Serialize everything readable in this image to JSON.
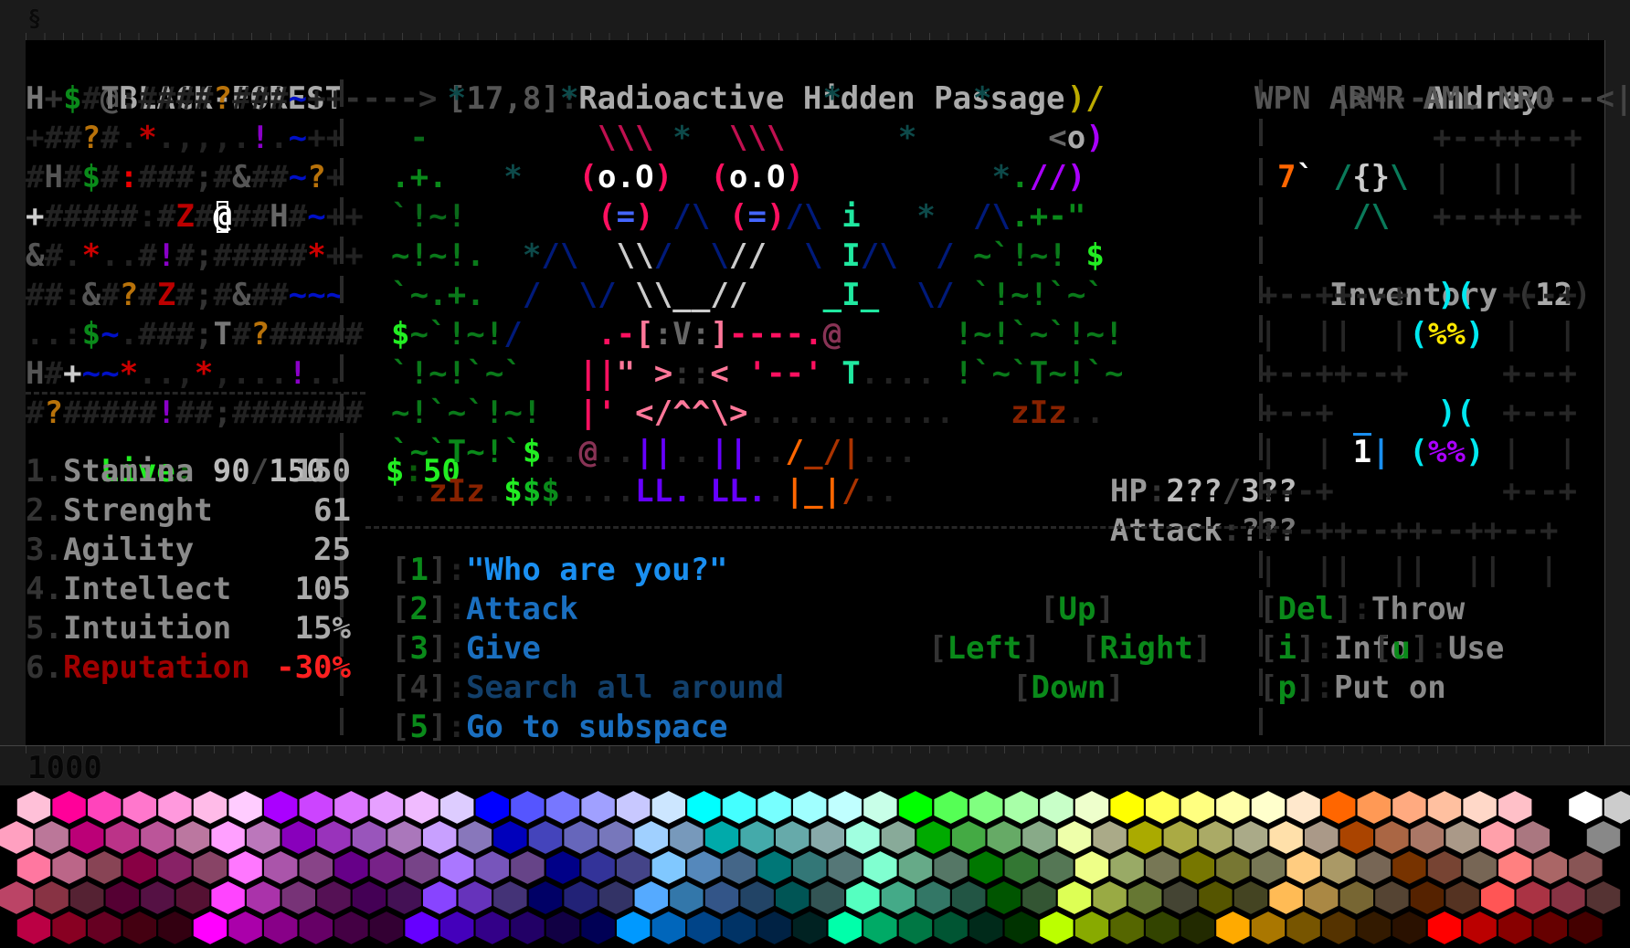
{
  "window": {
    "top_indicator": "§",
    "bottom_counter": "1000"
  },
  "header": {
    "location_left": "@BLACK-FOREST---->",
    "coords": "[17,8]",
    "coords_sep": ":",
    "location_title": "Radioactive Hidden Passage",
    "player_name": "Andrey",
    "player_frame_left": "|>---",
    "player_frame_right": "---<|"
  },
  "minimap": {
    "rows": [
      [
        [
          "H",
          "#777"
        ],
        [
          "+",
          "#333"
        ],
        [
          "$",
          "#0a8a1a"
        ],
        [
          "#",
          "#222"
        ],
        [
          "T",
          "#777"
        ],
        [
          ":",
          "#222"
        ],
        [
          "#",
          "#222"
        ],
        [
          "#",
          "#222"
        ],
        [
          "#",
          "#222"
        ],
        [
          "#",
          "#222"
        ],
        [
          "?",
          "#b8720a"
        ],
        [
          "#",
          "#222"
        ],
        [
          "#",
          "#222"
        ],
        [
          "#",
          "#222"
        ],
        [
          "~",
          "#0010c8"
        ],
        [
          "+",
          "#222"
        ],
        [
          "+",
          "#222"
        ]
      ],
      [
        [
          "+",
          "#222"
        ],
        [
          "#",
          "#222"
        ],
        [
          "#",
          "#222"
        ],
        [
          "?",
          "#b8720a"
        ],
        [
          "#",
          "#222"
        ],
        [
          ".",
          "#222"
        ],
        [
          "*",
          "#b00"
        ],
        [
          ".",
          "#222"
        ],
        [
          ",",
          "#222"
        ],
        [
          ",",
          "#222"
        ],
        [
          ",",
          "#222"
        ],
        [
          ".",
          "#222"
        ],
        [
          "!",
          "#8a00c8"
        ],
        [
          ".",
          "#222"
        ],
        [
          "~",
          "#0010c8"
        ],
        [
          "+",
          "#222"
        ],
        [
          "+",
          "#222"
        ]
      ],
      [
        [
          "#",
          "#222"
        ],
        [
          "H",
          "#555"
        ],
        [
          "#",
          "#222"
        ],
        [
          "$",
          "#0a8a1a"
        ],
        [
          "#",
          "#222"
        ],
        [
          ":",
          "#e00"
        ],
        [
          "#",
          "#222"
        ],
        [
          "#",
          "#222"
        ],
        [
          "#",
          "#222"
        ],
        [
          ";",
          "#333"
        ],
        [
          "#",
          "#222"
        ],
        [
          "&",
          "#555"
        ],
        [
          "#",
          "#222"
        ],
        [
          "#",
          "#222"
        ],
        [
          "~",
          "#0010c8"
        ],
        [
          "?",
          "#b8720a"
        ],
        [
          "+",
          "#222"
        ]
      ],
      [
        [
          "+",
          "#ccc"
        ],
        [
          "#",
          "#222"
        ],
        [
          "#",
          "#222"
        ],
        [
          "#",
          "#222"
        ],
        [
          "#",
          "#222"
        ],
        [
          "#",
          "#222"
        ],
        [
          ":",
          "#222"
        ],
        [
          "#",
          "#222"
        ],
        [
          "Z",
          "#b00"
        ],
        [
          "#",
          "#222"
        ],
        [
          "@",
          "#fff"
        ],
        [
          "#",
          "#222"
        ],
        [
          "#",
          "#222"
        ],
        [
          "H",
          "#666"
        ],
        [
          "#",
          "#222"
        ],
        [
          "~",
          "#0010c8"
        ],
        [
          "+",
          "#222"
        ],
        [
          "+",
          "#222"
        ]
      ],
      [
        [
          "&",
          "#555"
        ],
        [
          "#",
          "#222"
        ],
        [
          ".",
          "#222"
        ],
        [
          "*",
          "#c00"
        ],
        [
          ".",
          "#222"
        ],
        [
          ".",
          "#222"
        ],
        [
          "#",
          "#222"
        ],
        [
          "!",
          "#8a00c8"
        ],
        [
          "#",
          "#222"
        ],
        [
          ";",
          "#333"
        ],
        [
          "#",
          "#222"
        ],
        [
          "#",
          "#222"
        ],
        [
          "#",
          "#222"
        ],
        [
          "#",
          "#222"
        ],
        [
          "#",
          "#222"
        ],
        [
          "*",
          "#c00"
        ],
        [
          "+",
          "#222"
        ],
        [
          "+",
          "#222"
        ]
      ],
      [
        [
          "#",
          "#222"
        ],
        [
          "#",
          "#222"
        ],
        [
          ":",
          "#222"
        ],
        [
          "&",
          "#555"
        ],
        [
          "#",
          "#222"
        ],
        [
          "?",
          "#b8720a"
        ],
        [
          "#",
          "#222"
        ],
        [
          "Z",
          "#b00"
        ],
        [
          "#",
          "#222"
        ],
        [
          ";",
          "#333"
        ],
        [
          "#",
          "#222"
        ],
        [
          "&",
          "#555"
        ],
        [
          "#",
          "#222"
        ],
        [
          "#",
          "#222"
        ],
        [
          "~",
          "#0010c8"
        ],
        [
          "~",
          "#0010c8"
        ],
        [
          "~",
          "#0010c8"
        ]
      ],
      [
        [
          ".",
          "#222"
        ],
        [
          ".",
          "#222"
        ],
        [
          ":",
          "#222"
        ],
        [
          "$",
          "#0a8a1a"
        ],
        [
          "~",
          "#0010c8"
        ],
        [
          ".",
          "#222"
        ],
        [
          "#",
          "#222"
        ],
        [
          "#",
          "#222"
        ],
        [
          "#",
          "#222"
        ],
        [
          ";",
          "#333"
        ],
        [
          "T",
          "#777"
        ],
        [
          "#",
          "#222"
        ],
        [
          "?",
          "#b8720a"
        ],
        [
          "#",
          "#222"
        ],
        [
          "#",
          "#222"
        ],
        [
          "#",
          "#222"
        ],
        [
          "#",
          "#222"
        ],
        [
          "#",
          "#222"
        ]
      ],
      [
        [
          "H",
          "#555"
        ],
        [
          "#",
          "#222"
        ],
        [
          "+",
          "#ccc"
        ],
        [
          "~",
          "#0010c8"
        ],
        [
          "~",
          "#0010c8"
        ],
        [
          "*",
          "#c00"
        ],
        [
          ".",
          "#222"
        ],
        [
          ".",
          "#222"
        ],
        [
          ",",
          "#222"
        ],
        [
          "*",
          "#c00"
        ],
        [
          ",",
          "#222"
        ],
        [
          ".",
          "#222"
        ],
        [
          ".",
          "#222"
        ],
        [
          ".",
          "#222"
        ],
        [
          "!",
          "#8a00c8"
        ],
        [
          ".",
          "#222"
        ],
        [
          ".",
          "#222"
        ]
      ],
      [
        [
          "#",
          "#222"
        ],
        [
          "?",
          "#b8720a"
        ],
        [
          "#",
          "#222"
        ],
        [
          "#",
          "#222"
        ],
        [
          "#",
          "#222"
        ],
        [
          "#",
          "#222"
        ],
        [
          "#",
          "#222"
        ],
        [
          "!",
          "#8a00c8"
        ],
        [
          "#",
          "#222"
        ],
        [
          "#",
          "#222"
        ],
        [
          ";",
          "#333"
        ],
        [
          "#",
          "#222"
        ],
        [
          "#",
          "#222"
        ],
        [
          "#",
          "#222"
        ],
        [
          "#",
          "#222"
        ],
        [
          "#",
          "#222"
        ],
        [
          "#",
          "#222"
        ],
        [
          "#",
          "#222"
        ]
      ]
    ]
  },
  "status": {
    "live_label": "Live",
    "live_current": "90",
    "live_max": "150",
    "money_label": "$",
    "money": "50"
  },
  "stats": [
    {
      "num": "1.",
      "name": "Stamina",
      "value": "150",
      "color": "#8a8a8a"
    },
    {
      "num": "2.",
      "name": "Strenght",
      "value": "61",
      "color": "#8a8a8a"
    },
    {
      "num": "3.",
      "name": "Agility",
      "value": "25",
      "color": "#8a8a8a"
    },
    {
      "num": "4.",
      "name": "Intellect",
      "value": "105",
      "color": "#8a8a8a"
    },
    {
      "num": "5.",
      "name": "Intuition",
      "value": "15%",
      "color": "#8a8a8a"
    },
    {
      "num": "6.",
      "name": "Reputation",
      "value": "-30%",
      "color": "#a00000"
    }
  ],
  "enemy": {
    "hp_label": "HP",
    "hp_current": "2??",
    "hp_max": "3??",
    "attack_label": "Attack",
    "attack_value": "???"
  },
  "dialog": {
    "options": [
      {
        "key": "1",
        "label": "\"Who are you?\"",
        "color": "#1a8ff0"
      },
      {
        "key": "2",
        "label": "Attack",
        "color": "#1a6fc0"
      },
      {
        "key": "3",
        "label": "Give",
        "color": "#1a6fc0"
      },
      {
        "key": "4",
        "label": "Search all around",
        "color": "#123f6a",
        "disabled": true
      },
      {
        "key": "5",
        "label": "Go to subspace",
        "color": "#1a6fc0"
      }
    ],
    "directions": {
      "up": "Up",
      "left": "Left",
      "right": "Right",
      "down": "Down"
    }
  },
  "equipment": {
    "slots": [
      "WPN",
      "ARMR",
      "AML",
      "NRO"
    ]
  },
  "inventory": {
    "label": "Inventory",
    "count": "12",
    "item_count_badge": "1",
    "actions": [
      {
        "key": "Del",
        "label": "Throw"
      },
      {
        "key": "i",
        "label": "Info"
      },
      {
        "key": "u",
        "label": "Use"
      },
      {
        "key": "p",
        "label": "Put on"
      }
    ]
  },
  "palette": {
    "rows": [
      [
        "#ffc0d8",
        "#ff0099",
        "#ff44bb",
        "#ff77cc",
        "#ff99dd",
        "#ffbbe8",
        "#ffccff",
        "#aa00ff",
        "#cc44ff",
        "#dd77ff",
        "#e6a0ff",
        "#f0bbff",
        "#ddccff",
        "#0000ff",
        "#5555ff",
        "#7777ff",
        "#a0a0ff",
        "#c8c8ff",
        "#cce6ff",
        "#00ffff",
        "#44ffff",
        "#77ffff",
        "#a0ffff",
        "#c0ffff",
        "#c8ffe8",
        "#00ff00",
        "#55ff55",
        "#80ff80",
        "#a8ffa8",
        "#c8ffc8",
        "#eeffcc",
        "#ffff00",
        "#ffff55",
        "#ffff80",
        "#ffffaa",
        "#ffffcc",
        "#ffe8cc",
        "#ff6600",
        "#ff9955",
        "#ffaa80",
        "#ffc0a0",
        "#ffd8c8",
        "#ffc0c8",
        "",
        "#ffffff",
        "#cccccc"
      ],
      [
        "#ffa0c0",
        "#bb7799",
        "#bb0077",
        "#bb3388",
        "#bb5599",
        "#bb77a0",
        "#ffa0ff",
        "#bb77bb",
        "#8800bb",
        "#9933bb",
        "#9955bb",
        "#aa77bb",
        "#c8a0ff",
        "#8877bb",
        "#0000bb",
        "#4444bb",
        "#6666bb",
        "#7777bb",
        "#a0d0ff",
        "#7799bb",
        "#00aaaa",
        "#44aaaa",
        "#66aaaa",
        "#88aaaa",
        "#a0ffe0",
        "#88aa99",
        "#00aa00",
        "#44aa44",
        "#66aa66",
        "#88aa88",
        "#eeffaa",
        "#aaaa88",
        "#aaaa00",
        "#aaaa44",
        "#aaaa66",
        "#aaaa88",
        "#ffe0aa",
        "#aa9988",
        "#aa4400",
        "#aa6644",
        "#aa7766",
        "#aa9988",
        "#ffa0aa",
        "#aa7780",
        "",
        "#888888"
      ],
      [
        "#ff77a0",
        "#bb6688",
        "#884455",
        "#880044",
        "#882266",
        "#884466",
        "#ff77ff",
        "#aa55aa",
        "#884488",
        "#660088",
        "#772288",
        "#774488",
        "#aa77ff",
        "#7755bb",
        "#664488",
        "#000088",
        "#333399",
        "#444488",
        "#80c8ff",
        "#5588bb",
        "#446688",
        "#007777",
        "#337777",
        "#557777",
        "#80ffd0",
        "#66aa88",
        "#557766",
        "#007700",
        "#337733",
        "#557755",
        "#eeff88",
        "#99aa66",
        "#777755",
        "#777700",
        "#777733",
        "#777755",
        "#ffcc80",
        "#aa9966",
        "#776655",
        "#773300",
        "#774433",
        "#776655",
        "#ff8080",
        "#aa6666",
        "#885555",
        "",
        "#444444"
      ],
      [
        "#bb4466",
        "#883344",
        "#552233",
        "#550033",
        "#551144",
        "#551133",
        "#ff44ff",
        "#aa33aa",
        "#773377",
        "#551155",
        "#440055",
        "#441155",
        "#8844ff",
        "#6633bb",
        "#443377",
        "#000066",
        "#222277",
        "#333366",
        "#55aaff",
        "#3377aa",
        "#335588",
        "#224466",
        "#005555",
        "#335555",
        "#55ffc0",
        "#44aa88",
        "#337766",
        "#225544",
        "#005500",
        "#335533",
        "#ddff55",
        "#99aa44",
        "#667733",
        "#444433",
        "#555500",
        "#444422",
        "#ffbb55",
        "#aa8844",
        "#776633",
        "#554433",
        "#552200",
        "#553322",
        "#ff5555",
        "#aa3344",
        "#883344",
        "#553333"
      ],
      [
        "#bb0044",
        "#880022",
        "#660022",
        "#440011",
        "#330011",
        "#ff00ff",
        "#aa00aa",
        "#880088",
        "#660066",
        "#440044",
        "#330033",
        "#6600ff",
        "#4400bb",
        "#330088",
        "#220066",
        "#110044",
        "#000055",
        "#0099ff",
        "#0066bb",
        "#004488",
        "#003366",
        "#002244",
        "#002222",
        "#00ffaa",
        "#00aa66",
        "#007744",
        "#005533",
        "#002a1a",
        "#003300",
        "#bbff00",
        "#88aa00",
        "#556600",
        "#334400",
        "#222a00",
        "#ffaa00",
        "#aa7700",
        "#775500",
        "#553300",
        "#331a00",
        "#2a1100",
        "#ff0000",
        "#bb0000",
        "#880000",
        "#660000",
        "#440000"
      ]
    ]
  }
}
